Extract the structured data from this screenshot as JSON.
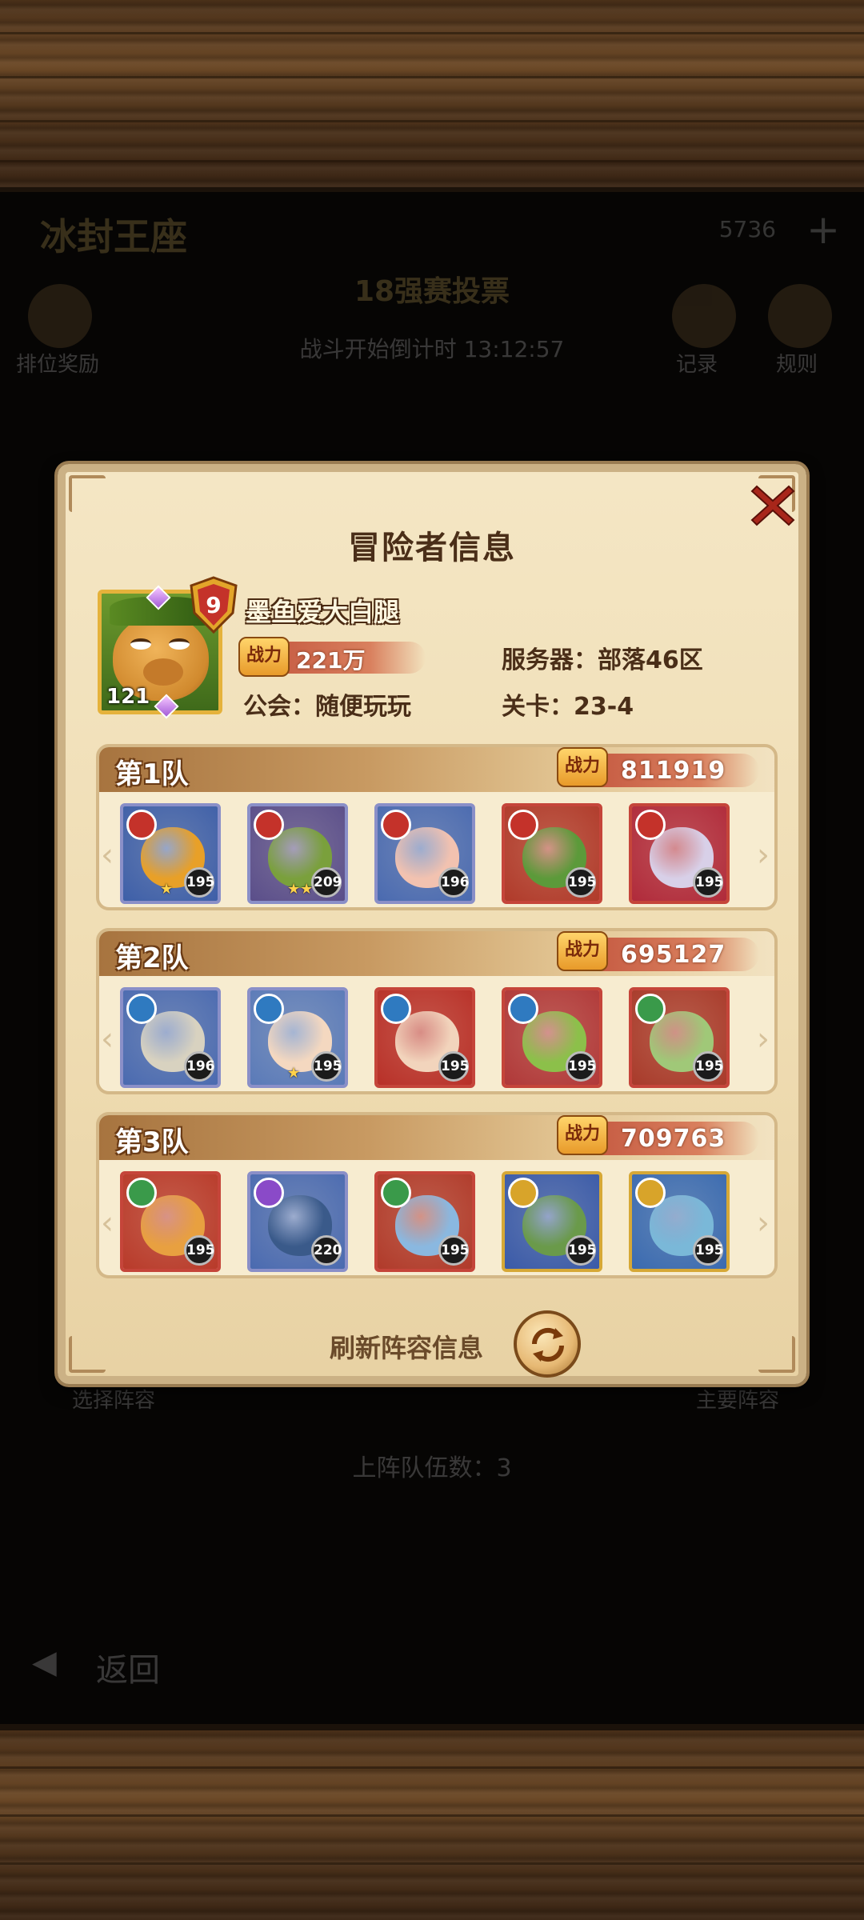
{
  "background": {
    "event_title": "冰封王座",
    "gems": "5736",
    "subtitle": "18强赛投票",
    "countdown": "战斗开始倒计时  13:12:57",
    "rank_reward": "排位奖励",
    "record": "记录",
    "rules": "规则",
    "team_count": "上阵队伍数：3",
    "back": "返回",
    "left_team": "选择阵容",
    "right_team": "主要阵容"
  },
  "modal": {
    "title": "冒险者信息",
    "player": {
      "name": "墨鱼爱大白腿",
      "level": "121",
      "vip": "9",
      "power_label": "战力",
      "power": "221万",
      "guild": "公会：随便玩玩",
      "server": "服务器：部落46区",
      "stage": "关卡：23-4"
    },
    "teams": [
      {
        "label": "第1队",
        "power_label": "战力",
        "power": "811919",
        "heroes": [
          {
            "level": "195",
            "stars": "★",
            "frame": "blue",
            "faction": "horde",
            "bg": "#3e5fa8",
            "face": "#e8a028"
          },
          {
            "level": "209",
            "stars": "★★",
            "frame": "blue",
            "faction": "horde",
            "bg": "#5a4e8a",
            "face": "#7aa03c"
          },
          {
            "level": "196",
            "stars": "",
            "frame": "blue",
            "faction": "horde",
            "bg": "#4a6ab0",
            "face": "#f2c2b0"
          },
          {
            "level": "195",
            "stars": "",
            "frame": "red",
            "faction": "horde",
            "bg": "#b03a2a",
            "face": "#5c9a3a"
          },
          {
            "level": "195",
            "stars": "",
            "frame": "red",
            "faction": "horde",
            "bg": "#b02a3a",
            "face": "#d8d0e8"
          }
        ]
      },
      {
        "label": "第2队",
        "power_label": "战力",
        "power": "695127",
        "heroes": [
          {
            "level": "196",
            "stars": "",
            "frame": "blue",
            "faction": "alliance",
            "bg": "#4a6ab0",
            "face": "#d8d2c0"
          },
          {
            "level": "195",
            "stars": "★",
            "frame": "blue",
            "faction": "alliance",
            "bg": "#5a7ab8",
            "face": "#f4d8c0"
          },
          {
            "level": "195",
            "stars": "",
            "frame": "red",
            "faction": "alliance",
            "bg": "#b83028",
            "face": "#f2d4bc"
          },
          {
            "level": "195",
            "stars": "",
            "frame": "red",
            "faction": "alliance",
            "bg": "#b03838",
            "face": "#8cc04a"
          },
          {
            "level": "195",
            "stars": "",
            "frame": "red",
            "faction": "nature",
            "bg": "#a83a2a",
            "face": "#a0c878"
          }
        ]
      },
      {
        "label": "第3队",
        "power_label": "战力",
        "power": "709763",
        "heroes": [
          {
            "level": "195",
            "stars": "",
            "frame": "red",
            "faction": "nature",
            "bg": "#b83a2a",
            "face": "#e8a040"
          },
          {
            "level": "220",
            "stars": "",
            "frame": "blue",
            "faction": "void",
            "bg": "#4a6ab0",
            "face": "#3a5a8a"
          },
          {
            "level": "195",
            "stars": "",
            "frame": "red",
            "faction": "nature",
            "bg": "#b03a2a",
            "face": "#8ab8e0"
          },
          {
            "level": "195",
            "stars": "",
            "frame": "gold",
            "faction": "light",
            "bg": "#3a5aa8",
            "face": "#6a9a4a"
          },
          {
            "level": "195",
            "stars": "",
            "frame": "gold",
            "faction": "light",
            "bg": "#3a6ab0",
            "face": "#7ab8d8"
          }
        ]
      }
    ],
    "refresh_label": "刷新阵容信息"
  },
  "colors": {
    "parchment": "#f4e6c4",
    "title_text": "#4a2e18",
    "power_red": "#c0503a",
    "close_red": "#a8261a"
  },
  "icons": {
    "close": "close-x-icon",
    "refresh": "refresh-arrows-icon",
    "vip": "vip-shield-icon",
    "power": "power-badge-icon"
  }
}
